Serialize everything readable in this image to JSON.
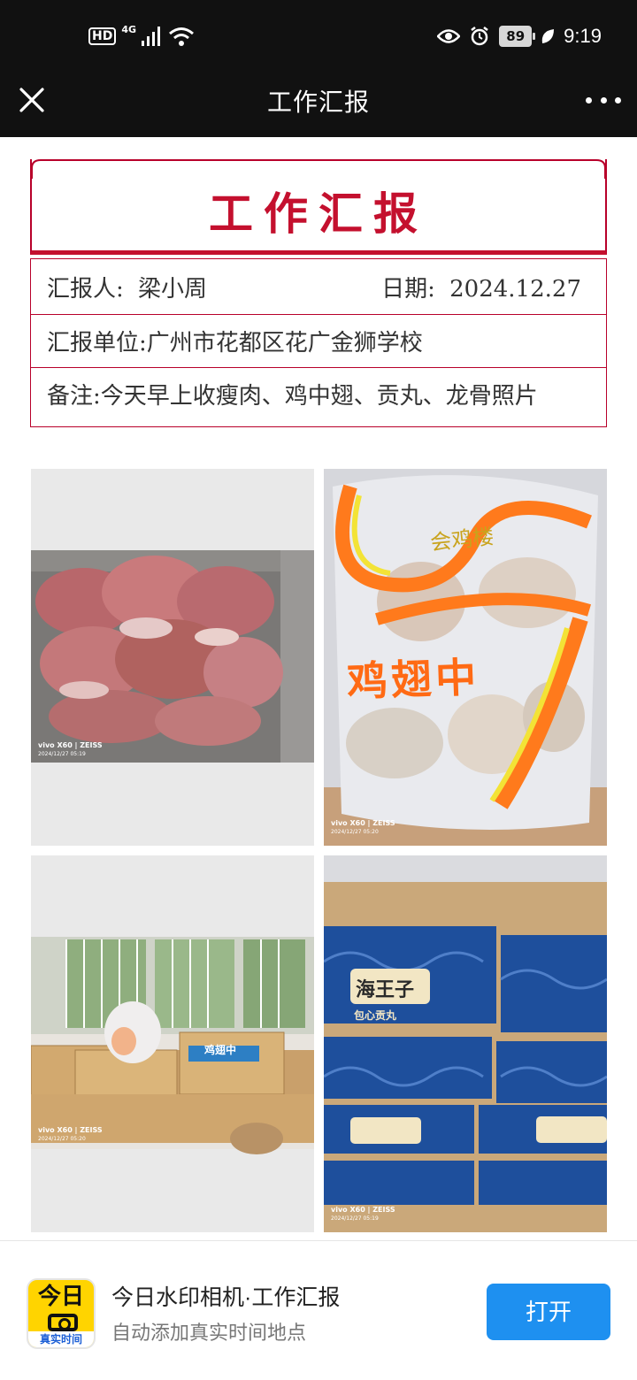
{
  "status_bar": {
    "hd": "HD",
    "network": "4G",
    "battery": "89",
    "time": "9:19",
    "icons": [
      "signal-icon",
      "wifi-icon",
      "eye-icon",
      "alarm-icon",
      "battery-icon",
      "leaf-icon"
    ]
  },
  "nav": {
    "title": "工作汇报",
    "close_icon": "close-icon",
    "more_icon": "more-dots-icon"
  },
  "report": {
    "title": "工作汇报",
    "reporter_label": "汇报人:",
    "reporter": "梁小周",
    "date_label": "日期:",
    "date": "2024.12.27",
    "unit_line": "汇报单位:广州市花都区花广金狮学校",
    "note_line": "备注:今天早上收瘦肉、鸡中翅、贡丸、龙骨照片",
    "accent_color": "#c4102e"
  },
  "photos": [
    {
      "camera": "vivo X60 | ZEISS",
      "timestamp": "2024/12/27 05:19"
    },
    {
      "camera": "vivo X60 | ZEISS",
      "timestamp": "2024/12/27 05:20",
      "label": "鸡翅中",
      "brand": "会鸡楼"
    },
    {
      "camera": "vivo X60 | ZEISS",
      "timestamp": "2024/12/27 05:20",
      "box_label": "鸡翅中"
    },
    {
      "camera": "vivo X60 | ZEISS",
      "timestamp": "2024/12/27 05:19",
      "box_label": "海王子",
      "box_sub": "包心贡丸"
    }
  ],
  "banner": {
    "app_icon_top": "今日",
    "app_icon_bottom": "真实时间",
    "app_name": "今日水印相机·工作汇报",
    "app_sub": "自动添加真实时间地点",
    "open_label": "打开",
    "button_color": "#1e90f0"
  }
}
